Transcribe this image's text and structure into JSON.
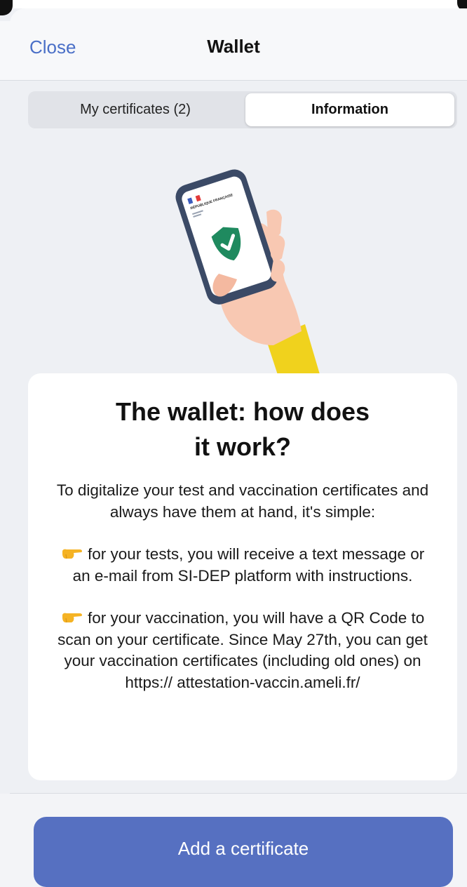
{
  "navbar": {
    "close_label": "Close",
    "title": "Wallet"
  },
  "tabs": [
    {
      "label": "My certificates (2)",
      "selected": false
    },
    {
      "label": "Information",
      "selected": true
    }
  ],
  "illustration": {
    "icon": "hand-holding-phone-with-shield-check",
    "phone_header_text": "RÉPUBLIQUE FRANÇAISE"
  },
  "card": {
    "title_line1": "The wallet: how does",
    "title_line2": "it work?",
    "intro": "To digitalize your test and vaccination certificates and always have them at hand, it's simple:",
    "tests_text": "for your tests, you will receive a text message or an e-mail from SI-DEP platform with instructions.",
    "vaccination_text": "for your vaccination, you will have a QR Code to scan on your certificate. Since May 27th, you can get your vaccination certificates (including old ones) on https:// attestation-vaccin.ameli.fr/",
    "bullet_icon": "pointing-hand-emoji"
  },
  "footer": {
    "add_button_label": "Add a certificate"
  },
  "colors": {
    "accent": "#4a6fc7",
    "button": "#5670c1",
    "background": "#eef0f4",
    "shield": "#1f8a5f",
    "sleeve": "#f0d21d"
  }
}
